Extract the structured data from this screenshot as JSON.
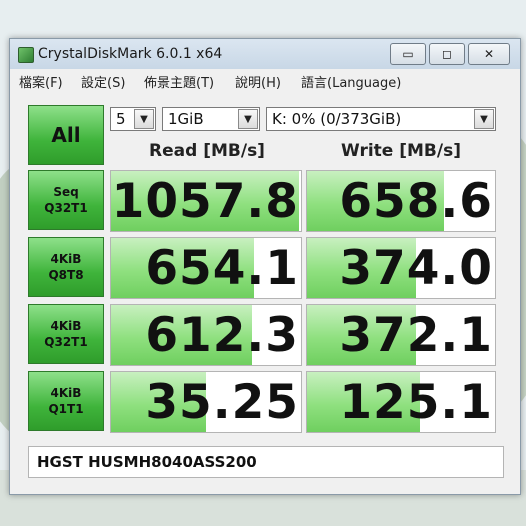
{
  "window": {
    "title": "CrystalDiskMark 6.0.1 x64",
    "minimize_label": "▭",
    "maximize_label": "◻",
    "close_label": "✕"
  },
  "menu": [
    {
      "label": "檔案(F)"
    },
    {
      "label": "設定(S)"
    },
    {
      "label": "佈景主題(T)"
    },
    {
      "label": "說明(H)"
    },
    {
      "label": "語言(Language)"
    }
  ],
  "controls": {
    "all_label": "All",
    "count": "5",
    "size": "1GiB",
    "drive": "K: 0% (0/373GiB)"
  },
  "headers": {
    "read": "Read [MB/s]",
    "write": "Write [MB/s]"
  },
  "tests": [
    {
      "line1": "Seq",
      "line2": "Q32T1",
      "read": "1057.8",
      "write": "658.6",
      "read_fill": 0.99,
      "write_fill": 0.73
    },
    {
      "line1": "4KiB",
      "line2": "Q8T8",
      "read": "654.1",
      "write": "374.0",
      "read_fill": 0.75,
      "write_fill": 0.58
    },
    {
      "line1": "4KiB",
      "line2": "Q32T1",
      "read": "612.3",
      "write": "372.1",
      "read_fill": 0.74,
      "write_fill": 0.58
    },
    {
      "line1": "4KiB",
      "line2": "Q1T1",
      "read": "35.25",
      "write": "125.1",
      "read_fill": 0.5,
      "write_fill": 0.6
    }
  ],
  "drive_model": "HGST HUSMH8040ASS200",
  "colors": {
    "button_green": "#3fb43b",
    "bar_green": "#8fe07f"
  }
}
